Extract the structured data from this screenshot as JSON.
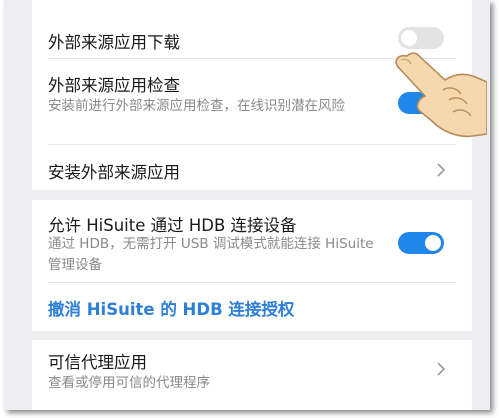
{
  "settings": {
    "external_download": {
      "title": "外部来源应用下载",
      "enabled": false
    },
    "external_check": {
      "title": "外部来源应用检查",
      "description": "安装前进行外部来源应用检查，在线识别潜在风险",
      "enabled": true
    },
    "install_external": {
      "title": "安装外部来源应用"
    },
    "hisuite_hdb": {
      "title": "允许 HiSuite 通过 HDB 连接设备",
      "description": "通过 HDB，无需打开 USB 调试模式就能连接 HiSuite 管理设备",
      "enabled": true
    },
    "revoke_hdb": {
      "label": "撤消 HiSuite 的 HDB 连接授权"
    },
    "trust_agents": {
      "title": "可信代理应用",
      "description": "查看或停用可信的代理程序"
    }
  },
  "colors": {
    "accent": "#1f87ea",
    "link": "#2e7fd8",
    "toggle_off": "#e3e3e3"
  },
  "icons": {
    "chevron": "chevron-right-icon",
    "pointer": "pointing-hand-icon"
  }
}
